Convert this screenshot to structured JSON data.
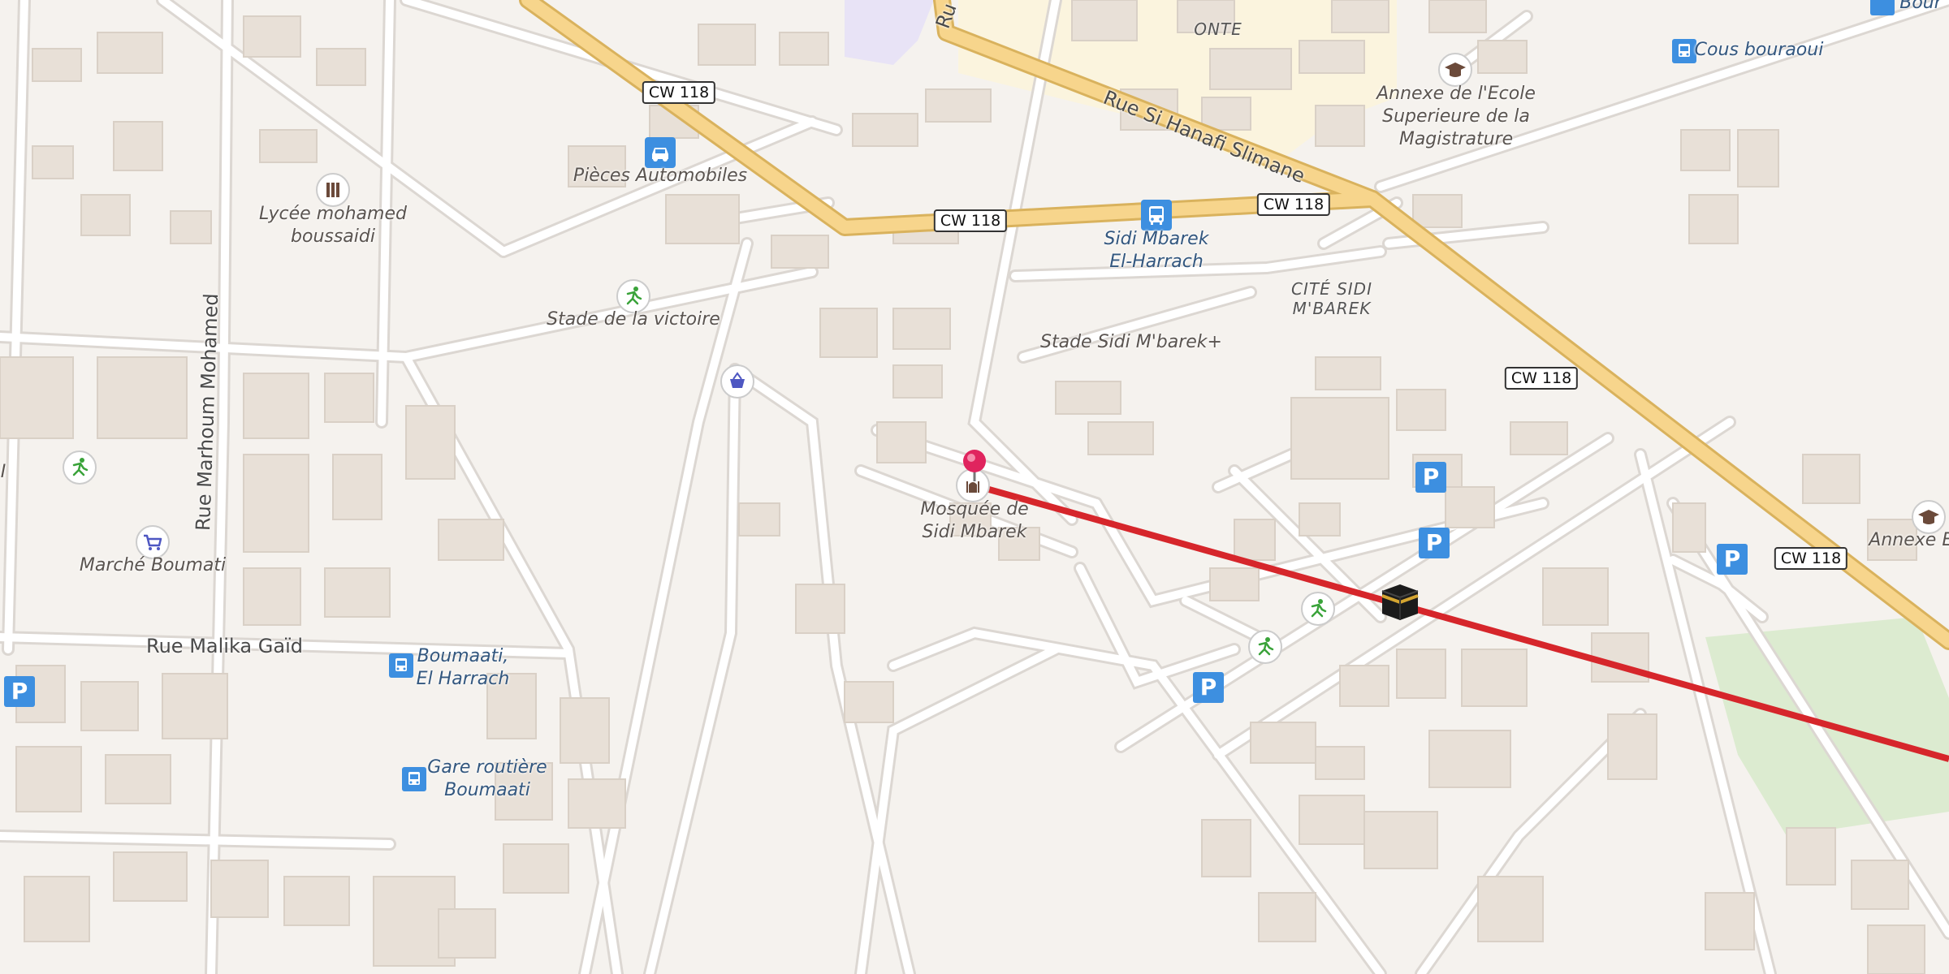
{
  "map": {
    "streets": {
      "rue_hanafi": "Rue Si Hanafi Slimane",
      "rue_top_clip": "Ru",
      "rue_marhoum": "Rue Marhoum Mohamed",
      "rue_malika": "Rue Malika Gaïd"
    },
    "shields": {
      "cw118_a": "CW 118",
      "cw118_b": "CW 118",
      "cw118_c": "CW 118",
      "cw118_d": "CW 118",
      "cw118_e": "CW 118"
    },
    "districts": {
      "onte": "ONTE",
      "cite_sidi": "CITÉ SIDI\nM'BAREK"
    },
    "pois": {
      "pieces": "Pièces Automobiles",
      "lycee": "Lycée mohamed\nboussaidi",
      "stade_victoire": "Stade de la victoire",
      "sidi_mbarek_bus": "Sidi Mbarek\nEl-Harrach",
      "stade_sidi": "Stade Sidi M'barek+",
      "mosquee": "Mosquée de\nSidi Mbarek",
      "annexe_ecole": "Annexe de l'Ecole\nSuperieure de la\nMagistrature",
      "cous": "Cous bouraoui",
      "bouraoui_clip": "Bour",
      "annexe_e": "Annexe E.I",
      "marche": "Marché Boumati",
      "boumaati_stop": "Boumaati,\nEl Harrach",
      "gare": "Gare routière\nBoumaati",
      "left_clip": "I"
    },
    "icons": {
      "mecca_marker": "kaaba-icon",
      "selected_pin": "map-pin-icon",
      "route_color": "#d6262b",
      "major_road_color": "#f7d58c",
      "parking_color": "#3d8fe0"
    }
  }
}
